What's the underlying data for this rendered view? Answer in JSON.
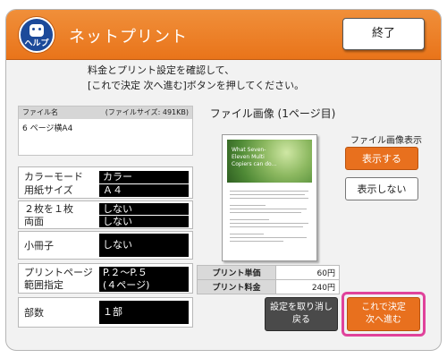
{
  "header": {
    "title": "ネットプリント",
    "help_label": "ヘルプ",
    "end_button": "終了"
  },
  "instruction": "料金とプリント設定を確認して、\n[これで決定 次へ進む]ボタンを押してください。",
  "file": {
    "name_label": "ファイル名",
    "size_label": "(ファイルサイズ: 491KB)",
    "file_name": "6 ページ横A4"
  },
  "settings": {
    "color_mode_label": "カラーモード",
    "color_mode_value": "カラー",
    "paper_size_label": "用紙サイズ",
    "paper_size_value": "Ａ４",
    "nup_label": "２枚を１枚",
    "nup_value": "しない",
    "duplex_label": "両面",
    "duplex_value": "しない",
    "booklet_label": "小冊子",
    "booklet_value": "しない",
    "pages_label_1": "プリントページ",
    "pages_label_2": "範囲指定",
    "pages_value_1": "P.２～P.５",
    "pages_value_2": "(４ページ)",
    "copies_label": "部数",
    "copies_value": "１部"
  },
  "preview": {
    "title": "ファイル画像 (1ページ目)",
    "image_text_1": "What Seven-",
    "image_text_2": "Eleven Multi",
    "image_text_3": "Copiers can do...",
    "display_label": "ファイル画像表示",
    "show_button": "表示する",
    "hide_button": "表示しない"
  },
  "price": {
    "unit_price_label": "プリント単価",
    "unit_price_value": "60円",
    "total_label": "プリント料金",
    "total_value": "240円"
  },
  "actions": {
    "cancel_line1": "設定を取り消し",
    "cancel_line2": "戻る",
    "next_line1": "これで決定",
    "next_line2": "次へ進む"
  },
  "colors": {
    "header_orange": "#e9741a",
    "accent_orange": "#e8701e",
    "highlight_pink": "#e0439b",
    "help_blue": "#1c4a9a"
  }
}
